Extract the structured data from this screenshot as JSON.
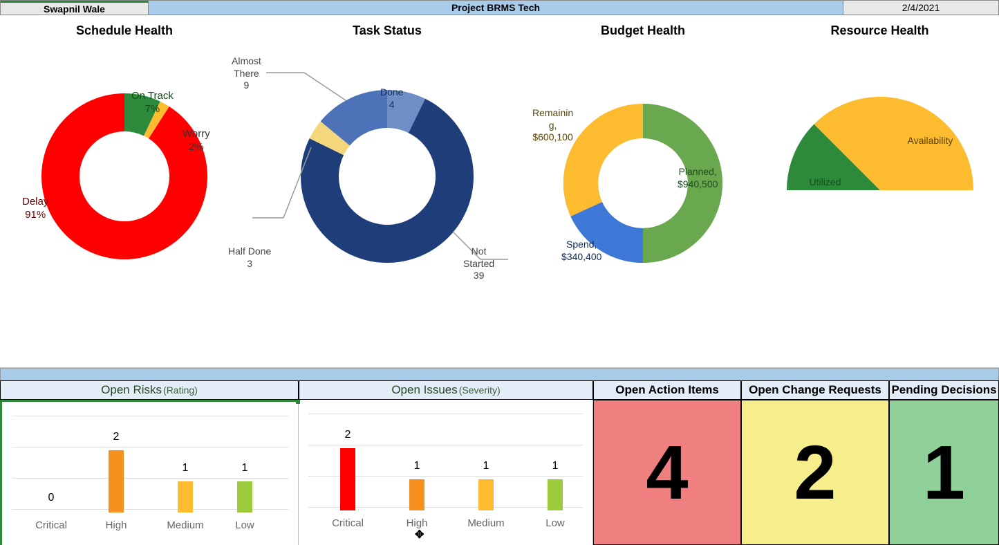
{
  "header": {
    "user": "Swapnil Wale",
    "project": "Project BRMS Tech",
    "date": "2/4/2021"
  },
  "charts": {
    "schedule": {
      "title": "Schedule Health",
      "delay_label": "Delay\n91%",
      "ontrack_label": "On Track\n7%",
      "worry_label": "Worry\n2%"
    },
    "taskstatus": {
      "title": "Task Status",
      "almost_label": "Almost\nThere\n9",
      "done_label": "Done\n4",
      "halfdone_label": "Half Done\n3",
      "notstarted_label": "Not\nStarted\n39"
    },
    "budget": {
      "title": "Budget Health",
      "remaining_label": "Remainin\ng,\n$600,100",
      "planned_label": "Planned,\n$940,500",
      "spend_label": "Spend,\n$340,400"
    },
    "resource": {
      "title": "Resource Health",
      "utilized_label": "Utilized",
      "availability_label": "Availability"
    }
  },
  "bottom": {
    "risks_title": "Open Risks",
    "risks_sub": "(Rating)",
    "issues_title": "Open Issues",
    "issues_sub": "(Severity)",
    "action_title": "Open Action Items",
    "change_title": "Open Change Requests",
    "pending_title": "Pending Decisions",
    "action_value": "4",
    "change_value": "2",
    "pending_value": "1",
    "cats": {
      "c0": "Critical",
      "c1": "High",
      "c2": "Medium",
      "c3": "Low"
    },
    "risks": {
      "v0": "0",
      "v1": "2",
      "v2": "1",
      "v3": "1"
    },
    "issues": {
      "v0": "2",
      "v1": "1",
      "v2": "1",
      "v3": "1"
    }
  },
  "chart_data": [
    {
      "type": "pie",
      "title": "Schedule Health",
      "series": [
        {
          "name": "Delay",
          "value": 91,
          "color": "#ff0000"
        },
        {
          "name": "On Track",
          "value": 7,
          "color": "#2c8a3a"
        },
        {
          "name": "Worry",
          "value": 2,
          "color": "#fdbb2f"
        }
      ]
    },
    {
      "type": "pie",
      "title": "Task Status",
      "series": [
        {
          "name": "Done",
          "value": 4,
          "color": "#6f8ec6"
        },
        {
          "name": "Not Started",
          "value": 39,
          "color": "#1f3e79"
        },
        {
          "name": "Half Done",
          "value": 3,
          "color": "#f4d77d"
        },
        {
          "name": "Almost There",
          "value": 9,
          "color": "#4d72b8"
        }
      ]
    },
    {
      "type": "pie",
      "title": "Budget Health",
      "series": [
        {
          "name": "Planned",
          "value": 940500,
          "color": "#6aa84f"
        },
        {
          "name": "Spend",
          "value": 340400,
          "color": "#3d78d6"
        },
        {
          "name": "Remaining",
          "value": 600100,
          "color": "#fdbb2f"
        }
      ]
    },
    {
      "type": "pie",
      "title": "Resource Health (semi)",
      "series": [
        {
          "name": "Utilized",
          "value": 25,
          "color": "#2c8a3a"
        },
        {
          "name": "Availability",
          "value": 75,
          "color": "#fdbb2f"
        }
      ]
    },
    {
      "type": "bar",
      "title": "Open Risks (Rating)",
      "categories": [
        "Critical",
        "High",
        "Medium",
        "Low"
      ],
      "values": [
        0,
        2,
        1,
        1
      ],
      "colors": [
        "#ff0000",
        "#f6901e",
        "#fdbb2f",
        "#9ccb3c"
      ],
      "ylim": [
        0,
        2
      ]
    },
    {
      "type": "bar",
      "title": "Open Issues (Severity)",
      "categories": [
        "Critical",
        "High",
        "Medium",
        "Low"
      ],
      "values": [
        2,
        1,
        1,
        1
      ],
      "colors": [
        "#ff0000",
        "#f6901e",
        "#fdbb2f",
        "#9ccb3c"
      ],
      "ylim": [
        0,
        2
      ]
    }
  ]
}
